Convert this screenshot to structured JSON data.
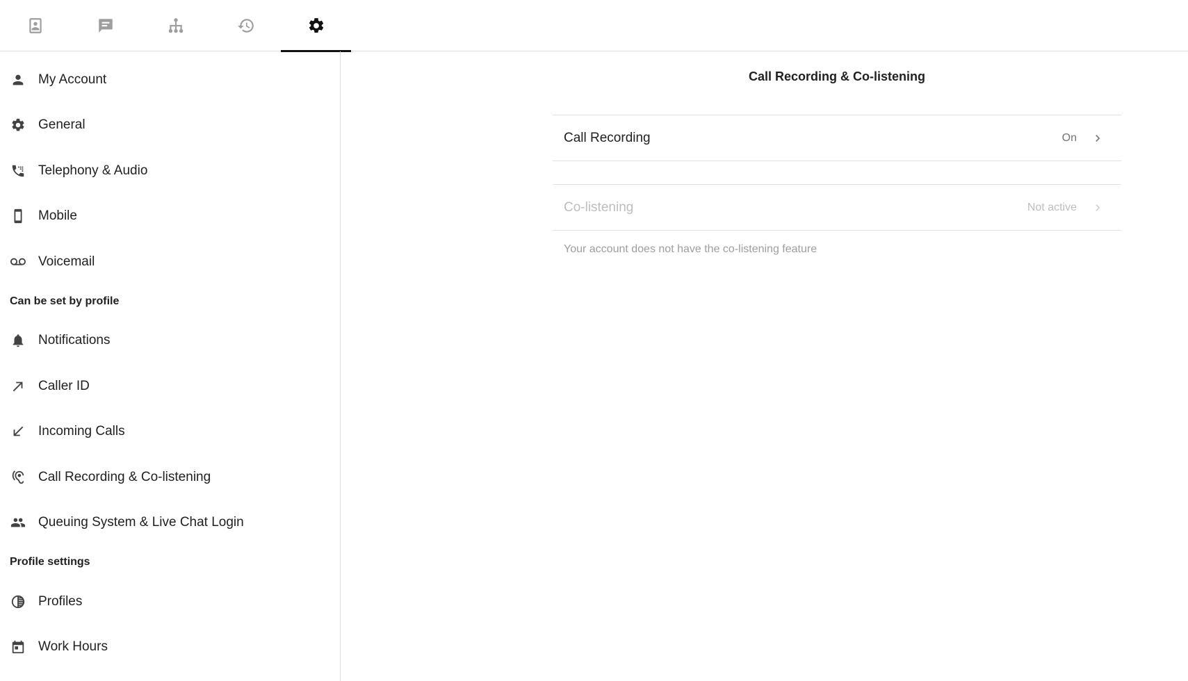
{
  "topbar": {
    "tabs": [
      {
        "icon": "contacts-icon",
        "active": false
      },
      {
        "icon": "chat-icon",
        "active": false
      },
      {
        "icon": "organization-icon",
        "active": false
      },
      {
        "icon": "history-icon",
        "active": false
      },
      {
        "icon": "gear-icon",
        "active": true
      }
    ]
  },
  "sidebar": {
    "items": [
      {
        "label": "My Account",
        "icon": "person-icon"
      },
      {
        "label": "General",
        "icon": "gear-icon"
      },
      {
        "label": "Telephony & Audio",
        "icon": "phone-dialpad-icon"
      },
      {
        "label": "Mobile",
        "icon": "smartphone-icon"
      },
      {
        "label": "Voicemail",
        "icon": "voicemail-icon"
      }
    ],
    "section_profile": "Can be set by profile",
    "profile_items": [
      {
        "label": "Notifications",
        "icon": "bell-icon"
      },
      {
        "label": "Caller ID",
        "icon": "arrow-up-right-icon"
      },
      {
        "label": "Incoming Calls",
        "icon": "arrow-down-left-icon"
      },
      {
        "label": "Call Recording & Co-listening",
        "icon": "hearing-icon"
      },
      {
        "label": "Queuing System & Live Chat Login",
        "icon": "people-icon"
      }
    ],
    "section_settings": "Profile settings",
    "settings_items": [
      {
        "label": "Profiles",
        "icon": "contrast-icon"
      },
      {
        "label": "Work Hours",
        "icon": "calendar-icon"
      }
    ]
  },
  "main": {
    "title": "Call Recording & Co-listening",
    "rows": [
      {
        "label": "Call Recording",
        "value": "On",
        "enabled": true
      },
      {
        "label": "Co-listening",
        "value": "Not active",
        "enabled": false
      }
    ],
    "hint": "Your account does not have the co-listening feature"
  },
  "colors": {
    "active_tab": "#111111",
    "inactive_icon": "#9e9e9e",
    "divider": "#e0e0e0",
    "disabled_text": "#bdbdbd"
  }
}
